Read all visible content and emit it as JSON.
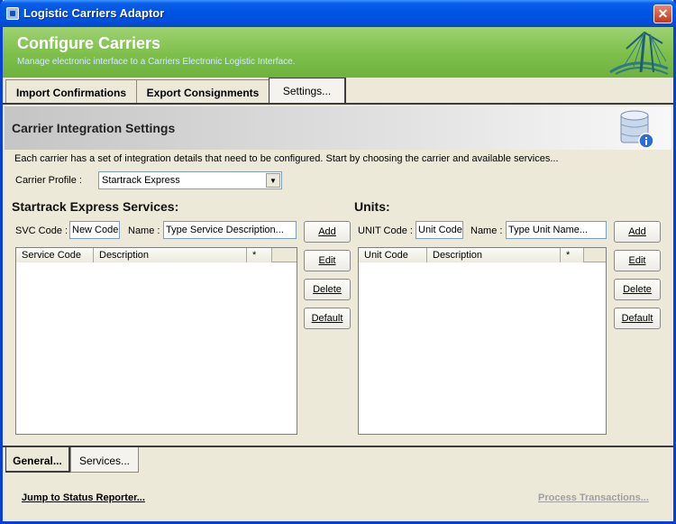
{
  "window": {
    "title": "Logistic Carriers Adaptor",
    "close_glyph": "✕"
  },
  "header": {
    "title": "Configure Carriers",
    "subtitle": "Manage electronic interface to a Carriers Electronic Logistic Interface."
  },
  "top_tabs": [
    {
      "label": "Import Confirmations"
    },
    {
      "label": "Export Consignments"
    },
    {
      "label": "Settings..."
    }
  ],
  "section": {
    "title": "Carrier Integration Settings",
    "description": "Each carrier has a set of integration details that need to be configured. Start by choosing the carrier and available services..."
  },
  "carrier_profile": {
    "label": "Carrier Profile :",
    "value": "Startrack Express"
  },
  "services": {
    "heading": "Startrack Express Services:",
    "code_label": "SVC Code :",
    "code_value": "New Code",
    "name_label": "Name :",
    "name_value": "Type Service Description...",
    "columns": [
      "Service Code",
      "Description",
      "*"
    ]
  },
  "units": {
    "heading": "Units:",
    "code_label": "UNIT Code :",
    "code_value": "Unit Code",
    "name_label": "Name :",
    "name_value": "Type Unit Name...",
    "columns": [
      "Unit Code",
      "Description",
      "*"
    ]
  },
  "buttons": {
    "add": "Add",
    "edit": "Edit",
    "delete": "Delete",
    "default": "Default"
  },
  "bottom_tabs": [
    {
      "label": "General..."
    },
    {
      "label": "Services..."
    }
  ],
  "footer": {
    "jump_link": "Jump to Status Reporter...",
    "process_link": "Process Transactions..."
  },
  "colors": {
    "header_green": "#7dbf4a",
    "titlebar_blue": "#0054e3",
    "disabled_text": "#a0a0a0"
  },
  "icons": [
    "app-icon",
    "close-icon",
    "bridge-logo-icon",
    "database-icon",
    "dropdown-arrow-icon"
  ]
}
